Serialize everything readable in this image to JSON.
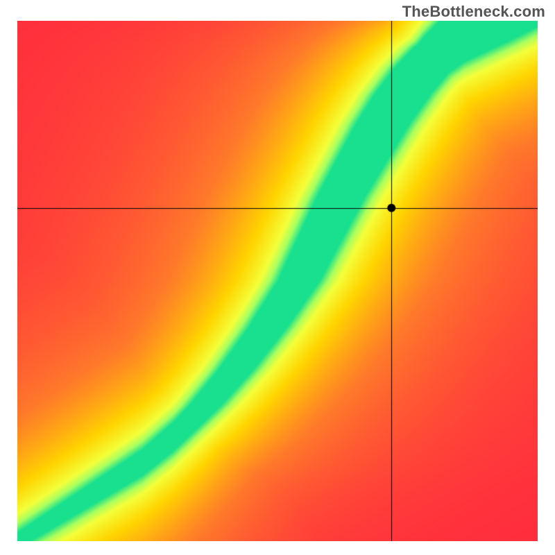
{
  "watermark": "TheBottleneck.com",
  "chart_data": {
    "type": "heatmap",
    "title": "",
    "xlabel": "",
    "ylabel": "",
    "xlim": [
      0,
      1
    ],
    "ylim": [
      0,
      1
    ],
    "crosshair": {
      "x": 0.72,
      "y": 0.64
    },
    "marker": {
      "x": 0.72,
      "y": 0.64,
      "radius": 6,
      "fill": "#000000"
    },
    "optimal_curve": {
      "description": "Green ridge — optimal pairing curve (value = 1); falls off to yellow/orange/red",
      "points": [
        {
          "x": 0.0,
          "y": 0.0
        },
        {
          "x": 0.08,
          "y": 0.05
        },
        {
          "x": 0.16,
          "y": 0.1
        },
        {
          "x": 0.24,
          "y": 0.15
        },
        {
          "x": 0.3,
          "y": 0.2
        },
        {
          "x": 0.36,
          "y": 0.26
        },
        {
          "x": 0.42,
          "y": 0.33
        },
        {
          "x": 0.48,
          "y": 0.41
        },
        {
          "x": 0.54,
          "y": 0.5
        },
        {
          "x": 0.58,
          "y": 0.58
        },
        {
          "x": 0.62,
          "y": 0.66
        },
        {
          "x": 0.66,
          "y": 0.73
        },
        {
          "x": 0.7,
          "y": 0.8
        },
        {
          "x": 0.74,
          "y": 0.86
        },
        {
          "x": 0.78,
          "y": 0.91
        },
        {
          "x": 0.82,
          "y": 0.95
        },
        {
          "x": 0.86,
          "y": 0.98
        },
        {
          "x": 0.9,
          "y": 1.0
        }
      ],
      "band_halfwidth_start": 0.015,
      "band_halfwidth_end": 0.06
    },
    "color_stops": [
      {
        "t": 0.0,
        "color": "#ff2a3e"
      },
      {
        "t": 0.4,
        "color": "#ff7a2a"
      },
      {
        "t": 0.7,
        "color": "#ffd400"
      },
      {
        "t": 0.86,
        "color": "#f4ff3a"
      },
      {
        "t": 0.93,
        "color": "#a8ff60"
      },
      {
        "t": 1.0,
        "color": "#18e08e"
      }
    ],
    "grid": false,
    "legend": false
  }
}
